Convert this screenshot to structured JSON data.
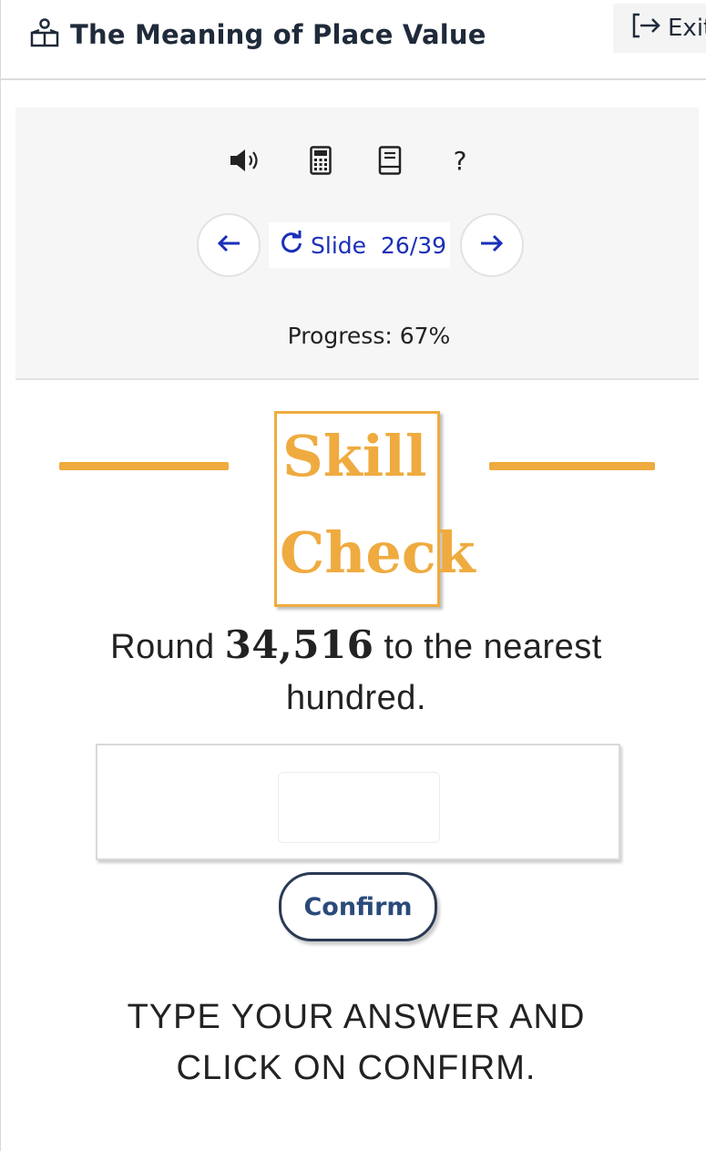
{
  "header": {
    "title": "The Meaning of Place Value",
    "title_icon": "podium-icon",
    "exit_label": "Exit",
    "exit_icon": "exit-arrow-icon"
  },
  "toolbar": {
    "icons": [
      "speaker-icon",
      "calculator-icon",
      "notebook-icon",
      "help-icon"
    ],
    "help_label": "?"
  },
  "navigation": {
    "prev_icon": "arrow-left-icon",
    "next_icon": "arrow-right-icon",
    "reload_icon": "reload-icon",
    "slide_label": "Slide",
    "slide_counter": "26/39",
    "current_slide": 26,
    "total_slides": 39
  },
  "progress": {
    "text": "Progress: 67%",
    "percent": 67
  },
  "skill_check": {
    "word1": "Skill",
    "word2": "Check",
    "accent_color": "#efab3f"
  },
  "question": {
    "prefix": "Round",
    "number": "34,516",
    "suffix": "to the nearest hundred."
  },
  "answer": {
    "value": "",
    "placeholder": ""
  },
  "confirm_label": "Confirm",
  "instruction": "TYPE YOUR ANSWER AND CLICK ON CONFIRM."
}
